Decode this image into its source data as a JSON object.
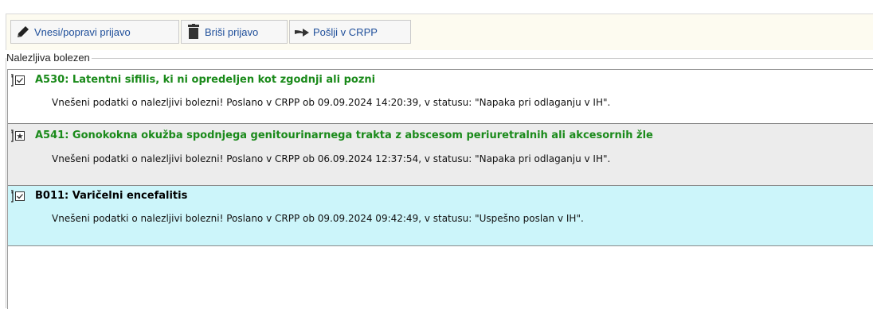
{
  "toolbar": {
    "buttons": [
      {
        "label": "Vnesi/popravi prijavo",
        "icon": "pencil-icon"
      },
      {
        "label": "Briši prijavo",
        "icon": "trash-icon"
      },
      {
        "label": "Pošlji v CRPP",
        "icon": "arrow-right-icon"
      }
    ]
  },
  "group": {
    "legend": "Nalezljiva bolezen",
    "items": [
      {
        "title": "A530: Latentni sifilis, ki ni opredeljen kot zgodnji ali pozni",
        "description": "Vnešeni podatki o nalezljivi bolezni! Poslano v CRPP ob 09.09.2024 14:20:39, v statusu: \"Napaka pri odlaganju v IH\".",
        "title_color": "#1a8a1a",
        "icon": "checkbox-checked-icon"
      },
      {
        "title": "A541: Gonokokna okužba spodnjega genitourinarnega trakta z abscesom periuretralnih ali akcesornih žle",
        "description": "Vnešeni podatki o nalezljivi bolezni! Poslano v CRPP ob 06.09.2024 12:37:54, v statusu: \"Napaka pri odlaganju v IH\".",
        "title_color": "#1a8a1a",
        "icon": "checkbox-star-icon"
      },
      {
        "title": "B011: Varičelni encefalitis",
        "description": "Vnešeni podatki o nalezljivi bolezni! Poslano v CRPP ob 09.09.2024 09:42:49, v statusu: \"Uspešno poslan v IH\".",
        "title_color": "#000000",
        "icon": "checkbox-checked-icon"
      }
    ]
  },
  "colors": {
    "toolbar_bg": "#fdfbf0",
    "button_text": "#1e4e9a",
    "selected_row_bg": "#ccf5fa",
    "alt_row_bg": "#ececec"
  }
}
